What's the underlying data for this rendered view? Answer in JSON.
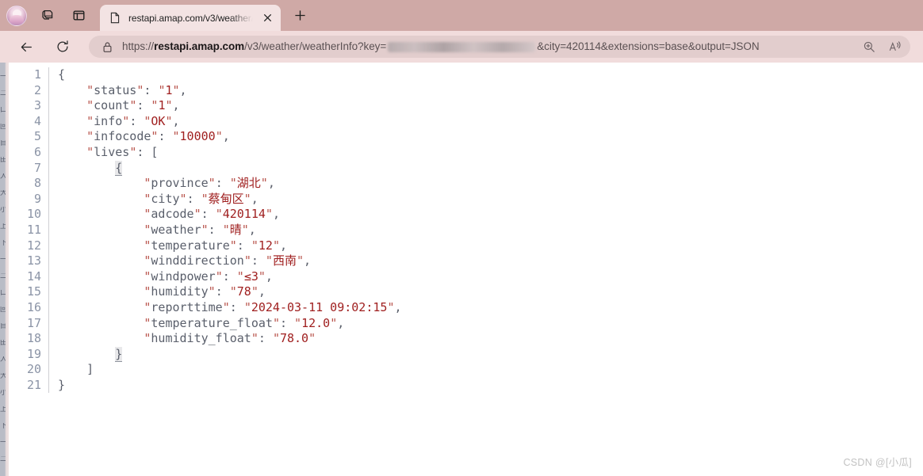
{
  "browser": {
    "avatar_label": "profile-avatar",
    "toolbar_icons": [
      {
        "name": "tab-groups-icon",
        "title": "Tab groups"
      },
      {
        "name": "split-screen-icon",
        "title": "Split screen"
      }
    ],
    "tab": {
      "title": "restapi.amap.com/v3/weather/we",
      "favicon_name": "page-favicon",
      "close_label": "Close tab"
    },
    "new_tab_label": "New tab",
    "nav": {
      "back_label": "Back",
      "reload_label": "Refresh"
    },
    "omnibox": {
      "lock_label": "Site information",
      "scheme": "https://",
      "host": "restapi.amap.com",
      "path": "/v3/weather/weatherInfo?key=",
      "redacted_label": "api-key-redacted",
      "query_tail": "&city=420114&extensions=base&output=JSON",
      "full_url": "https://restapi.amap.com/v3/weather/weatherInfo?key=&city=420114&extensions=base&output=JSON",
      "right_icons": [
        {
          "name": "zoom-icon",
          "title": "Zoom"
        },
        {
          "name": "read-aloud-icon",
          "title": "Read aloud"
        }
      ]
    }
  },
  "viewer": {
    "line_numbers": [
      "1",
      "2",
      "3",
      "4",
      "5",
      "6",
      "7",
      "8",
      "9",
      "10",
      "11",
      "12",
      "13",
      "14",
      "15",
      "16",
      "17",
      "18",
      "19",
      "20",
      "21"
    ],
    "lines": [
      {
        "n": "1",
        "indent": 0,
        "segments": [
          {
            "t": "{",
            "c": "br"
          }
        ]
      },
      {
        "n": "2",
        "indent": 4,
        "segments": [
          {
            "t": "\"",
            "c": "q"
          },
          {
            "t": "status",
            "c": "k"
          },
          {
            "t": "\"",
            "c": "q"
          },
          {
            "t": ": ",
            "c": "p"
          },
          {
            "t": "\"",
            "c": "q"
          },
          {
            "t": "1",
            "c": "v"
          },
          {
            "t": "\"",
            "c": "q"
          },
          {
            "t": ",",
            "c": "p"
          }
        ]
      },
      {
        "n": "3",
        "indent": 4,
        "segments": [
          {
            "t": "\"",
            "c": "q"
          },
          {
            "t": "count",
            "c": "k"
          },
          {
            "t": "\"",
            "c": "q"
          },
          {
            "t": ": ",
            "c": "p"
          },
          {
            "t": "\"",
            "c": "q"
          },
          {
            "t": "1",
            "c": "v"
          },
          {
            "t": "\"",
            "c": "q"
          },
          {
            "t": ",",
            "c": "p"
          }
        ]
      },
      {
        "n": "4",
        "indent": 4,
        "segments": [
          {
            "t": "\"",
            "c": "q"
          },
          {
            "t": "info",
            "c": "k"
          },
          {
            "t": "\"",
            "c": "q"
          },
          {
            "t": ": ",
            "c": "p"
          },
          {
            "t": "\"",
            "c": "q"
          },
          {
            "t": "OK",
            "c": "v"
          },
          {
            "t": "\"",
            "c": "q"
          },
          {
            "t": ",",
            "c": "p"
          }
        ]
      },
      {
        "n": "5",
        "indent": 4,
        "segments": [
          {
            "t": "\"",
            "c": "q"
          },
          {
            "t": "infocode",
            "c": "k"
          },
          {
            "t": "\"",
            "c": "q"
          },
          {
            "t": ": ",
            "c": "p"
          },
          {
            "t": "\"",
            "c": "q"
          },
          {
            "t": "10000",
            "c": "v"
          },
          {
            "t": "\"",
            "c": "q"
          },
          {
            "t": ",",
            "c": "p"
          }
        ]
      },
      {
        "n": "6",
        "indent": 4,
        "segments": [
          {
            "t": "\"",
            "c": "q"
          },
          {
            "t": "lives",
            "c": "k"
          },
          {
            "t": "\"",
            "c": "q"
          },
          {
            "t": ": ",
            "c": "p"
          },
          {
            "t": "[",
            "c": "br"
          }
        ]
      },
      {
        "n": "7",
        "indent": 8,
        "segments": [
          {
            "t": "{",
            "c": "brmatch"
          }
        ]
      },
      {
        "n": "8",
        "indent": 12,
        "segments": [
          {
            "t": "\"",
            "c": "q"
          },
          {
            "t": "province",
            "c": "k"
          },
          {
            "t": "\"",
            "c": "q"
          },
          {
            "t": ": ",
            "c": "p"
          },
          {
            "t": "\"",
            "c": "q"
          },
          {
            "t": "湖北",
            "c": "v"
          },
          {
            "t": "\"",
            "c": "q"
          },
          {
            "t": ",",
            "c": "p"
          }
        ]
      },
      {
        "n": "9",
        "indent": 12,
        "segments": [
          {
            "t": "\"",
            "c": "q"
          },
          {
            "t": "city",
            "c": "k"
          },
          {
            "t": "\"",
            "c": "q"
          },
          {
            "t": ": ",
            "c": "p"
          },
          {
            "t": "\"",
            "c": "q"
          },
          {
            "t": "蔡甸区",
            "c": "v"
          },
          {
            "t": "\"",
            "c": "q"
          },
          {
            "t": ",",
            "c": "p"
          }
        ]
      },
      {
        "n": "10",
        "indent": 12,
        "segments": [
          {
            "t": "\"",
            "c": "q"
          },
          {
            "t": "adcode",
            "c": "k"
          },
          {
            "t": "\"",
            "c": "q"
          },
          {
            "t": ": ",
            "c": "p"
          },
          {
            "t": "\"",
            "c": "q"
          },
          {
            "t": "420114",
            "c": "v"
          },
          {
            "t": "\"",
            "c": "q"
          },
          {
            "t": ",",
            "c": "p"
          }
        ]
      },
      {
        "n": "11",
        "indent": 12,
        "segments": [
          {
            "t": "\"",
            "c": "q"
          },
          {
            "t": "weather",
            "c": "k"
          },
          {
            "t": "\"",
            "c": "q"
          },
          {
            "t": ": ",
            "c": "p"
          },
          {
            "t": "\"",
            "c": "q"
          },
          {
            "t": "晴",
            "c": "v"
          },
          {
            "t": "\"",
            "c": "q"
          },
          {
            "t": ",",
            "c": "p"
          }
        ]
      },
      {
        "n": "12",
        "indent": 12,
        "segments": [
          {
            "t": "\"",
            "c": "q"
          },
          {
            "t": "temperature",
            "c": "k"
          },
          {
            "t": "\"",
            "c": "q"
          },
          {
            "t": ": ",
            "c": "p"
          },
          {
            "t": "\"",
            "c": "q"
          },
          {
            "t": "12",
            "c": "v"
          },
          {
            "t": "\"",
            "c": "q"
          },
          {
            "t": ",",
            "c": "p"
          }
        ]
      },
      {
        "n": "13",
        "indent": 12,
        "segments": [
          {
            "t": "\"",
            "c": "q"
          },
          {
            "t": "winddirection",
            "c": "k"
          },
          {
            "t": "\"",
            "c": "q"
          },
          {
            "t": ": ",
            "c": "p"
          },
          {
            "t": "\"",
            "c": "q"
          },
          {
            "t": "西南",
            "c": "v"
          },
          {
            "t": "\"",
            "c": "q"
          },
          {
            "t": ",",
            "c": "p"
          }
        ]
      },
      {
        "n": "14",
        "indent": 12,
        "segments": [
          {
            "t": "\"",
            "c": "q"
          },
          {
            "t": "windpower",
            "c": "k"
          },
          {
            "t": "\"",
            "c": "q"
          },
          {
            "t": ": ",
            "c": "p"
          },
          {
            "t": "\"",
            "c": "q"
          },
          {
            "t": "≤3",
            "c": "v"
          },
          {
            "t": "\"",
            "c": "q"
          },
          {
            "t": ",",
            "c": "p"
          }
        ]
      },
      {
        "n": "15",
        "indent": 12,
        "segments": [
          {
            "t": "\"",
            "c": "q"
          },
          {
            "t": "humidity",
            "c": "k"
          },
          {
            "t": "\"",
            "c": "q"
          },
          {
            "t": ": ",
            "c": "p"
          },
          {
            "t": "\"",
            "c": "q"
          },
          {
            "t": "78",
            "c": "v"
          },
          {
            "t": "\"",
            "c": "q"
          },
          {
            "t": ",",
            "c": "p"
          }
        ]
      },
      {
        "n": "16",
        "indent": 12,
        "segments": [
          {
            "t": "\"",
            "c": "q"
          },
          {
            "t": "reporttime",
            "c": "k"
          },
          {
            "t": "\"",
            "c": "q"
          },
          {
            "t": ": ",
            "c": "p"
          },
          {
            "t": "\"",
            "c": "q"
          },
          {
            "t": "2024-03-11 09:02:15",
            "c": "v"
          },
          {
            "t": "\"",
            "c": "q"
          },
          {
            "t": ",",
            "c": "p"
          }
        ]
      },
      {
        "n": "17",
        "indent": 12,
        "segments": [
          {
            "t": "\"",
            "c": "q"
          },
          {
            "t": "temperature_float",
            "c": "k"
          },
          {
            "t": "\"",
            "c": "q"
          },
          {
            "t": ": ",
            "c": "p"
          },
          {
            "t": "\"",
            "c": "q"
          },
          {
            "t": "12.0",
            "c": "v"
          },
          {
            "t": "\"",
            "c": "q"
          },
          {
            "t": ",",
            "c": "p"
          }
        ]
      },
      {
        "n": "18",
        "indent": 12,
        "segments": [
          {
            "t": "\"",
            "c": "q"
          },
          {
            "t": "humidity_float",
            "c": "k"
          },
          {
            "t": "\"",
            "c": "q"
          },
          {
            "t": ": ",
            "c": "p"
          },
          {
            "t": "\"",
            "c": "q"
          },
          {
            "t": "78.0",
            "c": "v"
          },
          {
            "t": "\"",
            "c": "q"
          }
        ]
      },
      {
        "n": "19",
        "indent": 8,
        "segments": [
          {
            "t": "}",
            "c": "brmatch"
          }
        ]
      },
      {
        "n": "20",
        "indent": 4,
        "segments": [
          {
            "t": "]",
            "c": "br"
          }
        ]
      },
      {
        "n": "21",
        "indent": 0,
        "segments": [
          {
            "t": "}",
            "c": "br"
          }
        ]
      }
    ],
    "payload": {
      "status": "1",
      "count": "1",
      "info": "OK",
      "infocode": "10000",
      "lives": [
        {
          "province": "湖北",
          "city": "蔡甸区",
          "adcode": "420114",
          "weather": "晴",
          "temperature": "12",
          "winddirection": "西南",
          "windpower": "≤3",
          "humidity": "78",
          "reporttime": "2024-03-11 09:02:15",
          "temperature_float": "12.0",
          "humidity_float": "78.0"
        }
      ]
    }
  },
  "watermark": {
    "text": "CSDN @[小瓜]"
  },
  "colors": {
    "tabstrip_bg": "#cfa9a6",
    "navbar_bg": "#f1dcdc",
    "active_tab_bg": "#f3e3e3",
    "omnibox_bg": "#e2cdcd",
    "json_key": "#5a5f6b",
    "json_value": "#a02020",
    "json_quote": "#b9554d",
    "lineno": "#8b94a6",
    "content_bg": "#ffffff",
    "watermark": "#c2c2c2"
  }
}
